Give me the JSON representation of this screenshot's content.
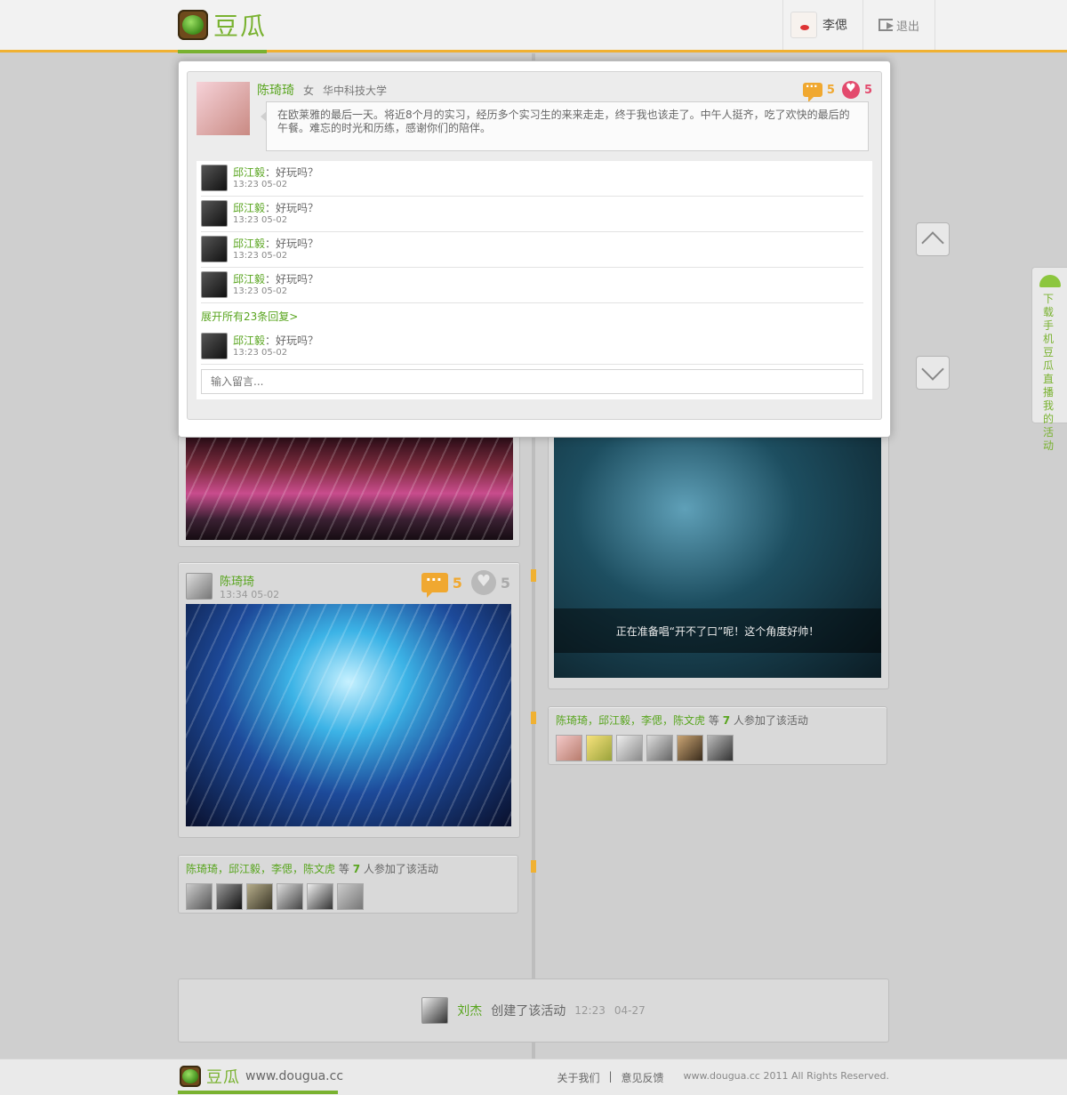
{
  "header": {
    "logo_text": "豆瓜",
    "user_name": "李偲",
    "logout_label": "退出"
  },
  "modal": {
    "author": "陈琦琦",
    "gender": "女",
    "school": "华中科技大学",
    "comment_count": "5",
    "like_count": "5",
    "post_text": "在欧莱雅的最后一天。将近8个月的实习，经历多个实习生的来来走走，终于我也该走了。中午人挺齐，吃了欢快的最后的午餐。难忘的时光和历练，感谢你们的陪伴。",
    "replies": [
      {
        "name": "邱江毅",
        "sep": "：",
        "text": "好玩吗？",
        "time": "13:23 05-02"
      },
      {
        "name": "邱江毅",
        "sep": "：",
        "text": "好玩吗？",
        "time": "13:23 05-02"
      },
      {
        "name": "邱江毅",
        "sep": "：",
        "text": "好玩吗？",
        "time": "13:23 05-02"
      },
      {
        "name": "邱江毅",
        "sep": "：",
        "text": "好玩吗？",
        "time": "13:23 05-02"
      }
    ],
    "expand_label": "展开所有23条回复>",
    "last_reply": {
      "name": "邱江毅",
      "sep": "：",
      "text": "好玩吗？",
      "time": "13:23 05-02"
    },
    "input_placeholder": "输入留言..."
  },
  "left_post": {
    "author": "陈琦琦",
    "time": "13:34 05-02",
    "comment_count": "5",
    "like_count": "5"
  },
  "right_photo": {
    "caption": "正在准备唱“开不了口”呢！这个角度好帅！"
  },
  "participants_right": {
    "names": "陈琦琦，邱江毅，李偲，陈文虎",
    "mid": "等",
    "count": "7",
    "suffix": "人参加了该活动"
  },
  "participants_left": {
    "names": "陈琦琦，邱江毅，李偲，陈文虎",
    "mid": "等",
    "count": "7",
    "suffix": "人参加了该活动"
  },
  "creator": {
    "name": "刘杰",
    "action": "创建了该活动",
    "time": "12:23",
    "date": "04-27"
  },
  "side_tab": {
    "text": "下载手机豆瓜直播我的活动"
  },
  "footer": {
    "logo_text": "豆瓜",
    "url": "www.dougua.cc",
    "about": "关于我们",
    "divider": "|",
    "feedback": "意见反馈",
    "copyright": "www.dougua.cc 2011 All Rights Reserved."
  },
  "colors": {
    "accent_green": "#79b230",
    "accent_orange": "#f0b132",
    "like_pink": "#e34a6d"
  }
}
